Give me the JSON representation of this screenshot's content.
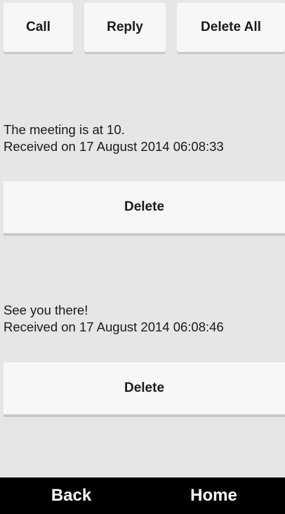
{
  "toolbar": {
    "call_label": "Call",
    "reply_label": "Reply",
    "delete_all_label": "Delete All"
  },
  "messages": [
    {
      "text": "The meeting is at 10.",
      "received": "Received on 17 August 2014 06:08:33",
      "delete_label": "Delete"
    },
    {
      "text": "See you there!",
      "received": "Received on 17 August 2014 06:08:46",
      "delete_label": "Delete"
    }
  ],
  "navigation": {
    "back_label": "Back",
    "home_label": "Home"
  },
  "colors": {
    "background": "#e6e6e6",
    "button_background": "#f7f7f7",
    "nav_bar_background": "#000000",
    "nav_text": "#ffffff"
  }
}
